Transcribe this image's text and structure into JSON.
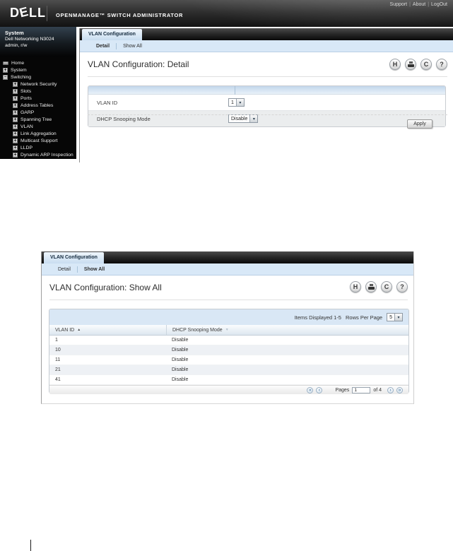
{
  "theme": {
    "topbar_dark": "#2c2c2c",
    "active_tab_blue": "#c8ddf0",
    "subtab_bar_blue": "#d8e8f7",
    "table_topbar_blue": "#d9e7f5",
    "row_alt_blue": "#eef1f5"
  },
  "topbar": {
    "brand_letters": [
      "D",
      "E",
      "L",
      "L"
    ],
    "app_title": "OPENMANAGE™ SWITCH ADMINISTRATOR",
    "links": [
      "Support",
      "About",
      "LogOut"
    ],
    "link_sep": "|"
  },
  "sidebar": {
    "system_label": "System",
    "device_name": "Dell Networking N3024",
    "user_role": "admin, r/w",
    "tree": [
      {
        "label": "Home"
      },
      {
        "label": "System"
      },
      {
        "label": "Switching"
      },
      {
        "label": "Network Security"
      },
      {
        "label": "Slots"
      },
      {
        "label": "Ports"
      },
      {
        "label": "Address Tables"
      },
      {
        "label": "GARP"
      },
      {
        "label": "Spanning Tree"
      },
      {
        "label": "VLAN"
      },
      {
        "label": "Link Aggregation"
      },
      {
        "label": "Multicast Support"
      },
      {
        "label": "LLDP"
      },
      {
        "label": "Dynamic ARP Inspection"
      }
    ]
  },
  "icons": {
    "save": "H",
    "refresh": "C",
    "help": "?",
    "select_arrow": "▾",
    "sort_asc": "▲",
    "sort_desc": "▼",
    "page_first": "«",
    "page_prev": "‹",
    "page_next": "›",
    "page_last": "»",
    "tree_plus": "+",
    "tree_minus": "−"
  },
  "panel_detail": {
    "tab": "VLAN Configuration",
    "subtab_detail": "Detail",
    "subtab_showall": "Show All",
    "title": "VLAN Configuration: Detail",
    "form": {
      "rows": [
        {
          "label": "VLAN ID",
          "value": "1"
        },
        {
          "label": "DHCP Snooping Mode",
          "value": "Disable"
        }
      ]
    },
    "apply_label": "Apply"
  },
  "panel_showall": {
    "tab": "VLAN Configuration",
    "subtab_detail": "Detail",
    "subtab_showall": "Show All",
    "title": "VLAN Configuration: Show All",
    "items_displayed": "Items Displayed 1-5",
    "rows_per_page_label": "Rows Per Page",
    "rows_per_page_value": "5",
    "columns": [
      "VLAN ID",
      "DHCP Snooping Mode"
    ],
    "rows": [
      [
        "1",
        "Disable"
      ],
      [
        "10",
        "Disable"
      ],
      [
        "11",
        "Disable"
      ],
      [
        "21",
        "Disable"
      ],
      [
        "41",
        "Disable"
      ]
    ],
    "pages_label": "Pages",
    "page_value": "1",
    "pages_of": "of 4"
  }
}
